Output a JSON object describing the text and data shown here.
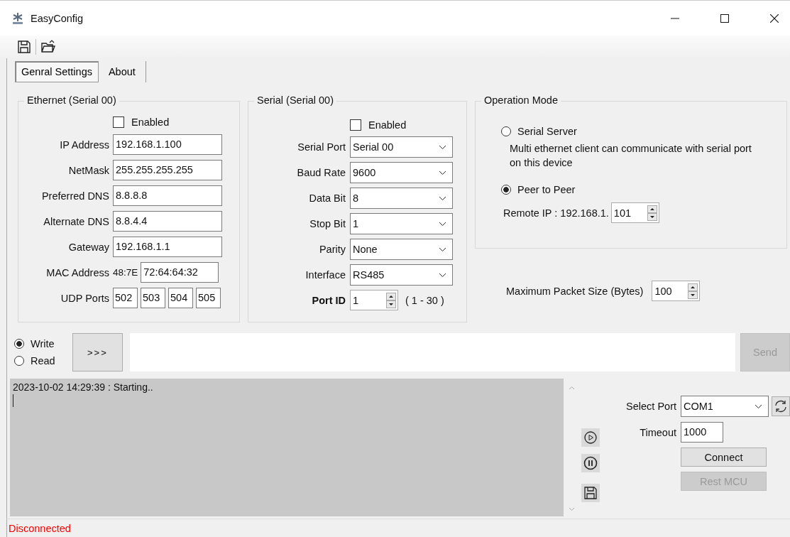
{
  "window": {
    "title": "EasyConfig"
  },
  "tabs": [
    {
      "label": "Genral Settings",
      "selected": true
    },
    {
      "label": "About",
      "selected": false
    }
  ],
  "ethernet": {
    "title": "Ethernet (Serial 00)",
    "enabled": {
      "label": "Enabled",
      "checked": false
    },
    "fields": [
      {
        "label": "IP Address",
        "value": "192.168.1.100"
      },
      {
        "label": "NetMask",
        "value": "255.255.255.255"
      },
      {
        "label": "Preferred DNS",
        "value": "8.8.8.8"
      },
      {
        "label": "Alternate DNS",
        "value": "8.8.4.4"
      },
      {
        "label": "Gateway",
        "value": "192.168.1.1"
      }
    ],
    "mac": {
      "label": "MAC Address",
      "prefix": "48:7E",
      "value": "72:64:64:32"
    },
    "udp": {
      "label": "UDP Ports",
      "values": [
        "502",
        "503",
        "504",
        "505"
      ]
    }
  },
  "serial": {
    "title": "Serial (Serial 00)",
    "enabled": {
      "label": "Enabled",
      "checked": false
    },
    "selects": [
      {
        "label": "Serial Port",
        "value": "Serial 00"
      },
      {
        "label": "Baud Rate",
        "value": "9600"
      },
      {
        "label": "Data Bit",
        "value": "8"
      },
      {
        "label": "Stop Bit",
        "value": "1"
      },
      {
        "label": "Parity",
        "value": "None"
      },
      {
        "label": "Interface",
        "value": "RS485"
      }
    ],
    "port_id": {
      "label": "Port ID",
      "value": "1",
      "range": "( 1 - 30 )"
    }
  },
  "operation_mode": {
    "title": "Operation Mode",
    "options": [
      {
        "label": "Serial Server",
        "selected": false,
        "description": "Multi ethernet client can communicate with serial port on this device"
      },
      {
        "label": "Peer to Peer",
        "selected": true
      }
    ],
    "remote_ip": {
      "label": "Remote IP : 192.168.1.",
      "value": "101"
    }
  },
  "max_packet": {
    "label": "Maximum Packet Size (Bytes)",
    "value": "100"
  },
  "direction": [
    {
      "label": "Write",
      "selected": true
    },
    {
      "label": "Read",
      "selected": false
    }
  ],
  "arrow_button": {
    "label": ">>>"
  },
  "send_button": {
    "label": "Send",
    "disabled": true
  },
  "log": {
    "lines": [
      "2023-10-02 14:29:39 : Starting.."
    ]
  },
  "port": {
    "label": "Select Port",
    "value": "COM1"
  },
  "timeout": {
    "label": "Timeout",
    "value": "1000"
  },
  "connect_button": {
    "label": "Connect",
    "disabled": false
  },
  "reset_button": {
    "label": "Rest MCU",
    "disabled": true
  },
  "status_bar": {
    "text": "Disconnected"
  }
}
